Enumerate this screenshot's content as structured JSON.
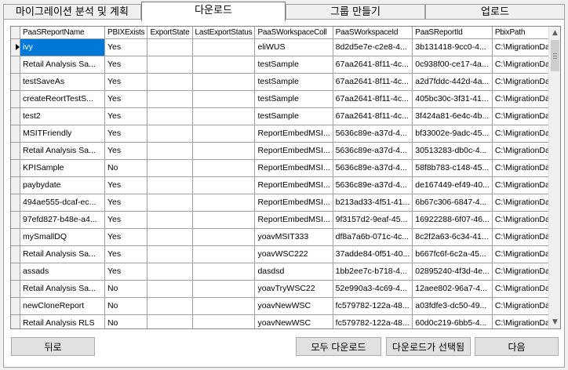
{
  "tabs": [
    {
      "label": "마이그레이션 분석 및 계획",
      "active": false
    },
    {
      "label": "다운로드",
      "active": true
    },
    {
      "label": "그룹 만들기",
      "active": false
    },
    {
      "label": "업로드",
      "active": false
    }
  ],
  "grid": {
    "columns": [
      "PaaSReportName",
      "PBIXExists",
      "ExportState",
      "LastExportStatus",
      "PaaSWorkspaceColl",
      "PaaSWorkspaceId",
      "PaaSReportId",
      "PbixPath"
    ],
    "rows": [
      [
        "ivy",
        "Yes",
        "",
        "",
        "eliWUS",
        "8d2d5e7e-c2e8-4...",
        "3b131418-9cc0-4...",
        "C:\\MigrationData\\..."
      ],
      [
        "Retail Analysis Sa...",
        "Yes",
        "",
        "",
        "testSample",
        "67aa2641-8f11-4c...",
        "0c938f00-ce17-4a...",
        "C:\\MigrationData\\..."
      ],
      [
        "testSaveAs",
        "Yes",
        "",
        "",
        "testSample",
        "67aa2641-8f11-4c...",
        "a2d7fddc-442d-4a...",
        "C:\\MigrationData\\..."
      ],
      [
        "createReortTestS...",
        "Yes",
        "",
        "",
        "testSample",
        "67aa2641-8f11-4c...",
        "405bc30c-3f31-41...",
        "C:\\MigrationData\\..."
      ],
      [
        "test2",
        "Yes",
        "",
        "",
        "testSample",
        "67aa2641-8f11-4c...",
        "3f424a81-6e4c-4b...",
        "C:\\MigrationData\\..."
      ],
      [
        "MSITFriendly",
        "Yes",
        "",
        "",
        "ReportEmbedMSI...",
        "5636c89e-a37d-4...",
        "bf33002e-9adc-45...",
        "C:\\MigrationData\\..."
      ],
      [
        "Retail Analysis Sa...",
        "Yes",
        "",
        "",
        "ReportEmbedMSI...",
        "5636c89e-a37d-4...",
        "30513283-db0c-4...",
        "C:\\MigrationData\\..."
      ],
      [
        "KPISample",
        "No",
        "",
        "",
        "ReportEmbedMSI...",
        "5636c89e-a37d-4...",
        "58f8b783-c148-45...",
        "C:\\MigrationData\\..."
      ],
      [
        "paybydate",
        "Yes",
        "",
        "",
        "ReportEmbedMSI...",
        "5636c89e-a37d-4...",
        "de167449-ef49-40...",
        "C:\\MigrationData\\..."
      ],
      [
        "494ae555-dcaf-ec...",
        "Yes",
        "",
        "",
        "ReportEmbedMSI...",
        "b213ad33-4f51-41...",
        "6b67c306-6847-4...",
        "C:\\MigrationData\\..."
      ],
      [
        "97efd827-b48e-a4...",
        "Yes",
        "",
        "",
        "ReportEmbedMSI...",
        "9f3157d2-9eaf-45...",
        "16922288-6f07-46...",
        "C:\\MigrationData\\..."
      ],
      [
        "mySmallDQ",
        "Yes",
        "",
        "",
        "yoavMSIT333",
        "df8a7a6b-071c-4c...",
        "8c2f2a63-6c34-41...",
        "C:\\MigrationData\\..."
      ],
      [
        "Retail Analysis Sa...",
        "Yes",
        "",
        "",
        "yoavWSC222",
        "37adde84-0f51-40...",
        "b667fc6f-6c2a-45...",
        "C:\\MigrationData\\..."
      ],
      [
        "assads",
        "Yes",
        "",
        "",
        "dasdsd",
        "1bb2ee7c-b718-4...",
        "02895240-4f3d-4e...",
        "C:\\MigrationData\\..."
      ],
      [
        "Retail Analysis Sa...",
        "No",
        "",
        "",
        "yoavTryWSC22",
        "52e990a3-4c69-4...",
        "12aee802-96a7-4...",
        "C:\\MigrationData\\..."
      ],
      [
        "newCloneReport",
        "No",
        "",
        "",
        "yoavNewWSC",
        "fc579782-122a-48...",
        "a03fdfe3-dc50-49...",
        "C:\\MigrationData\\..."
      ],
      [
        "Retail Analysis RLS",
        "No",
        "",
        "",
        "yoavNewWSC",
        "fc579782-122a-48...",
        "60d0c219-6bb5-4...",
        "C:\\MigrationData\\..."
      ],
      [
        "DQ-cenatestSQLAz...",
        "No",
        "",
        "",
        "yoavNewWSC",
        "fc579782-122a-48...",
        "9c640fab-024c-4a...",
        "C:\\MigrationData\\..."
      ]
    ],
    "selected_row": 0
  },
  "buttons": {
    "back": "뒤로",
    "download_all": "모두 다운로드",
    "download_selected": "다운로드가 선택됨",
    "next": "다음"
  },
  "icons": {
    "current_row": "row-pointer-icon",
    "scroll_up": "scroll-up-icon",
    "scroll_down": "scroll-down-icon"
  }
}
